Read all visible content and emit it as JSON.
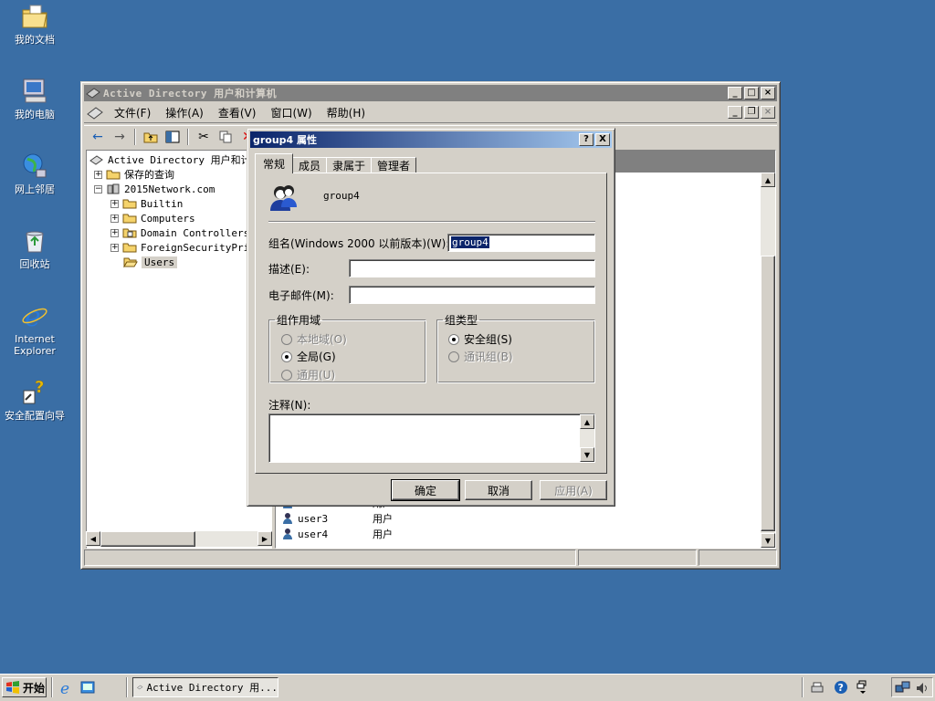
{
  "desktop": {
    "icons": [
      {
        "label": "我的文档"
      },
      {
        "label": "我的电脑"
      },
      {
        "label": "网上邻居"
      },
      {
        "label": "回收站"
      },
      {
        "label": "Internet Explorer"
      },
      {
        "label": "安全配置向导"
      }
    ]
  },
  "window": {
    "title": "Active Directory 用户和计算机",
    "menu": [
      "文件(F)",
      "操作(A)",
      "查看(V)",
      "窗口(W)",
      "帮助(H)"
    ],
    "tree": {
      "root": "Active Directory 用户和计算机",
      "saved_queries": "保存的查询",
      "domain": "2015Network.com",
      "children": [
        "Builtin",
        "Computers",
        "Domain Controllers",
        "ForeignSecurityPrincipals",
        "Users"
      ]
    },
    "list_rows": [
      {
        "name": "user2",
        "type": "用户"
      },
      {
        "name": "user3",
        "type": "用户"
      },
      {
        "name": "user4",
        "type": "用户"
      }
    ]
  },
  "dialog": {
    "title": "group4 属性",
    "help_btn": "?",
    "close_btn": "X",
    "tabs": [
      "常规",
      "成员",
      "隶属于",
      "管理者"
    ],
    "group_name": "group4",
    "prewin2000_label": "组名(Windows 2000 以前版本)(W):",
    "prewin2000_value": "group4",
    "description_label": "描述(E):",
    "description_value": "",
    "email_label": "电子邮件(M):",
    "email_value": "",
    "scope": {
      "legend": "组作用域",
      "options": [
        {
          "label": "本地域(O)",
          "selected": false,
          "disabled": true
        },
        {
          "label": "全局(G)",
          "selected": true,
          "disabled": false
        },
        {
          "label": "通用(U)",
          "selected": false,
          "disabled": true
        }
      ]
    },
    "type": {
      "legend": "组类型",
      "options": [
        {
          "label": "安全组(S)",
          "selected": true,
          "disabled": false
        },
        {
          "label": "通讯组(B)",
          "selected": false,
          "disabled": true
        }
      ]
    },
    "notes_label": "注释(N):",
    "notes_value": "",
    "buttons": {
      "ok": "确定",
      "cancel": "取消",
      "apply": "应用(A)"
    }
  },
  "taskbar": {
    "start": "开始",
    "task": "Active Directory 用..."
  },
  "colors": {
    "desktop": "#3a6ea5",
    "face": "#d4d0c8",
    "active_title": "#0a246a",
    "inactive_title": "#808080"
  }
}
